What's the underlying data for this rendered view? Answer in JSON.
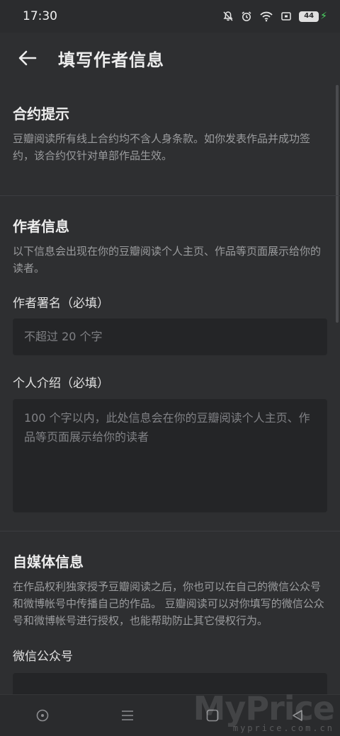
{
  "status_bar": {
    "time": "17:30",
    "battery_level": "44"
  },
  "app_bar": {
    "title": "填写作者信息"
  },
  "contract_notice": {
    "heading": "合约提示",
    "body": "豆瓣阅读所有线上合约均不含人身条款。如你发表作品并成功签约，该合约仅针对单部作品生效。"
  },
  "author_info": {
    "heading": "作者信息",
    "body": "以下信息会出现在你的豆瓣阅读个人主页、作品等页面展示给你的读者。",
    "pen_name": {
      "label": "作者署名（必填）",
      "placeholder": "不超过 20 个字"
    },
    "bio": {
      "label": "个人介绍（必填）",
      "placeholder": "100 个字以内，此处信息会在你的豆瓣阅读个人主页、作品等页面展示给你的读者"
    }
  },
  "media_info": {
    "heading": "自媒体信息",
    "body": "在作品权利独家授予豆瓣阅读之后，你也可以在自己的微信公众号和微博帐号中传播自己的作品。 豆瓣阅读可以对你填写的微信公众号和微博帐号进行授权，也能帮助防止其它侵权行为。",
    "wechat_label": "微信公众号"
  },
  "watermark": {
    "brand": "MyPrice",
    "url": "myprice.com.cn"
  },
  "icons": {
    "back": "arrow-left-icon",
    "nav": [
      "assistant-icon",
      "menu-icon",
      "home-icon",
      "back-triangle-icon"
    ]
  },
  "colors": {
    "background": "#2e2f31",
    "input": "#242527",
    "muted_text": "#9b9c9e"
  }
}
